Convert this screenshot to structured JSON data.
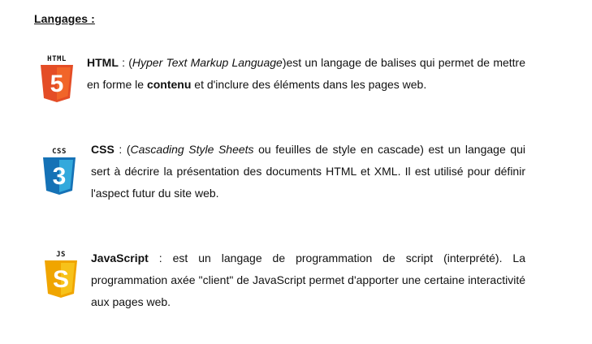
{
  "heading": "Langages :",
  "languages": [
    {
      "logo_label": "HTML",
      "logo_digit": "5",
      "logo_icon": "html5-icon",
      "logo_color": "#e44d26",
      "logo_color_light": "#f16529",
      "name": "HTML",
      "sep": " : (",
      "expansion": "Hyper Text Markup Language",
      "text_a": ")est un langage de balises qui permet de mettre en forme le ",
      "emphasis": "contenu",
      "text_b": " et d'inclure des éléments dans les pages web."
    },
    {
      "logo_label": "CSS",
      "logo_digit": "3",
      "logo_icon": "css3-icon",
      "logo_color": "#1572b6",
      "logo_color_light": "#33a9dc",
      "name": "CSS",
      "sep": " : (",
      "expansion": "Cascading Style Sheets",
      "text_a": " ou feuilles de style en cascade) est un langage qui sert à décrire la présentation des documents HTML et XML. Il est utilisé pour définir l'aspect futur du site web."
    },
    {
      "logo_label": "JS",
      "logo_digit": "S",
      "logo_icon": "javascript-icon",
      "logo_color": "#f0a500",
      "logo_color_light": "#f7c21a",
      "name": "JavaScript",
      "sep": " : ",
      "text_a": "est un langage de programmation de script (interprété). La programmation axée \"client\" de JavaScript permet d'apporter une certaine interactivité aux pages web."
    }
  ]
}
